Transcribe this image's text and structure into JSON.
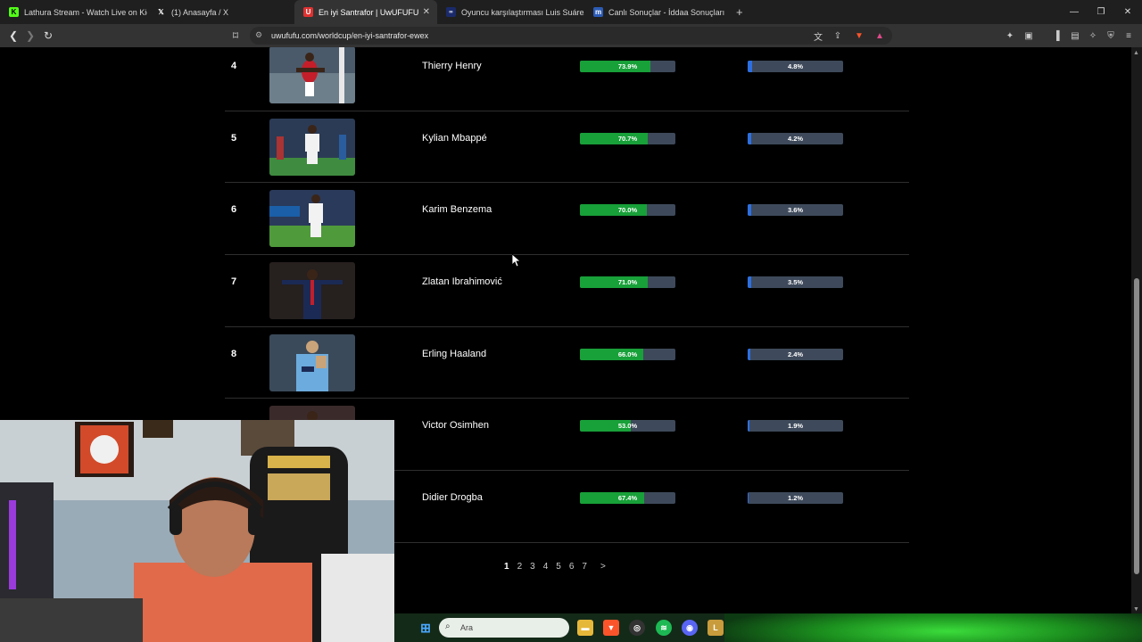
{
  "browser": {
    "tabs": [
      {
        "label": "Lathura Stream - Watch Live on Kick",
        "icon": "kick-icon",
        "color": "#53fc18"
      },
      {
        "label": "(1) Anasayfa / X",
        "icon": "x-icon",
        "color": "#000000"
      },
      {
        "label": "En iyi Santrafor | UwUFUFU",
        "icon": "uwufufu-icon",
        "color": "#e03131",
        "active": true
      },
      {
        "label": "Oyuncu karşılaştırması Luis Suárez / ",
        "icon": "site-icon",
        "color": "#1b2a6b"
      },
      {
        "label": "Canlı Sonuçlar - İddaa Sonuçları | Ma",
        "icon": "mackolik-icon",
        "color": "#2b5bb5"
      }
    ],
    "url": "uwufufu.com/worldcup/en-iyi-santrafor-ewex"
  },
  "rows": [
    {
      "rank": "4",
      "name": "Thierry Henry",
      "win_pct": 73.9,
      "win_label": "73.9%",
      "champ_pct": 4.8,
      "champ_label": "4.8%"
    },
    {
      "rank": "5",
      "name": "Kylian Mbappé",
      "win_pct": 70.7,
      "win_label": "70.7%",
      "champ_pct": 4.2,
      "champ_label": "4.2%"
    },
    {
      "rank": "6",
      "name": "Karim Benzema",
      "win_pct": 70.0,
      "win_label": "70.0%",
      "champ_pct": 3.6,
      "champ_label": "3.6%"
    },
    {
      "rank": "7",
      "name": "Zlatan Ibrahimović",
      "win_pct": 71.0,
      "win_label": "71.0%",
      "champ_pct": 3.5,
      "champ_label": "3.5%"
    },
    {
      "rank": "8",
      "name": "Erling Haaland",
      "win_pct": 66.0,
      "win_label": "66.0%",
      "champ_pct": 2.4,
      "champ_label": "2.4%"
    },
    {
      "rank": "",
      "name": "Victor Osimhen",
      "win_pct": 53.0,
      "win_label": "53.0%",
      "champ_pct": 1.9,
      "champ_label": "1.9%"
    },
    {
      "rank": "",
      "name": "Didier Drogba",
      "win_pct": 67.4,
      "win_label": "67.4%",
      "champ_pct": 1.2,
      "champ_label": "1.2%"
    }
  ],
  "pagination": {
    "pages": [
      "1",
      "2",
      "3",
      "4",
      "5",
      "6",
      "7"
    ],
    "current": "1",
    "next": ">"
  },
  "taskbar": {
    "search_placeholder": "Ara"
  },
  "colors": {
    "win_bar": "#18a039",
    "champ_bar": "#2d6fe0",
    "bar_track": "#3e4a5b"
  }
}
